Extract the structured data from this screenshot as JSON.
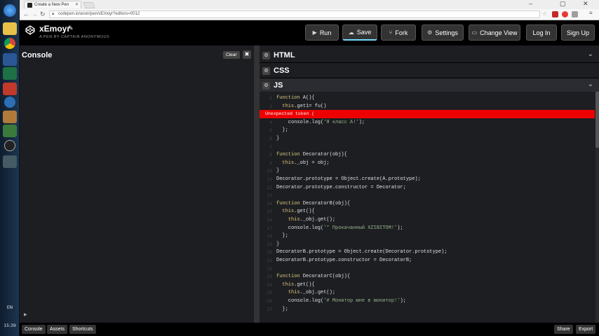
{
  "taskbar": {
    "icons": [
      "windows-start-icon",
      "folder-icon",
      "chrome-icon",
      "word-icon",
      "excel-icon",
      "app-icon",
      "globe-icon",
      "media-icon",
      "sound-icon",
      "obs-icon",
      "screen-icon"
    ],
    "lang": "EN",
    "time": "15:39"
  },
  "browser": {
    "tab_title": "Create a New Pen",
    "url": "codepen.io/anon/pen/xEmoyr?editors=0012"
  },
  "header": {
    "pen_title": "xEmoyr",
    "pen_subtitle": "A PEN BY CAPTAIN ANONYMOUS",
    "buttons": {
      "run": "Run",
      "save": "Save",
      "fork": "Fork",
      "settings": "Settings",
      "change_view": "Change View",
      "login": "Log In",
      "signup": "Sign Up"
    }
  },
  "console": {
    "title": "Console",
    "clear": "Clear",
    "prompt": "▶"
  },
  "editors": {
    "html": "HTML",
    "css": "CSS",
    "js": "JS"
  },
  "error": "Unexpected token (",
  "code_lines": [
    {
      "n": "1",
      "t": "function A(){"
    },
    {
      "n": "2",
      "t": "  this.get1= fu()"
    },
    {
      "n": "3",
      "t": ""
    },
    {
      "n": "4",
      "t": "    console.log('Я класс А!');"
    },
    {
      "n": "5",
      "t": "  };"
    },
    {
      "n": "6",
      "t": "}"
    },
    {
      "n": "7",
      "t": ""
    },
    {
      "n": "8",
      "t": "function Decorator(obj){"
    },
    {
      "n": "9",
      "t": "  this._obj = obj;"
    },
    {
      "n": "10",
      "t": "}"
    },
    {
      "n": "11",
      "t": "Decorator.prototype = Object.create(A.prototype);"
    },
    {
      "n": "12",
      "t": "Decorator.prototype.constructor = Decorator;"
    },
    {
      "n": "13",
      "t": ""
    },
    {
      "n": "14",
      "t": "function DecoratorB(obj){"
    },
    {
      "n": "15",
      "t": "  this.get(){"
    },
    {
      "n": "16",
      "t": "    this._obj.get();"
    },
    {
      "n": "17",
      "t": "    console.log('* Прокачанный XZIBITOM!');"
    },
    {
      "n": "18",
      "t": "  };"
    },
    {
      "n": "19",
      "t": "}"
    },
    {
      "n": "20",
      "t": "DecoratorB.prototype = Object.create(Decorator.prototype);"
    },
    {
      "n": "21",
      "t": "DecoratorB.prototype.constructor = DecoratorB;"
    },
    {
      "n": "22",
      "t": ""
    },
    {
      "n": "23",
      "t": "function DecoratorC(obj){"
    },
    {
      "n": "24",
      "t": "  this.get(){"
    },
    {
      "n": "25",
      "t": "    this._obj.get();"
    },
    {
      "n": "26",
      "t": "    console.log('# Монитор мне в монитор!');"
    },
    {
      "n": "27",
      "t": "  };"
    }
  ],
  "footer": {
    "console": "Console",
    "assets": "Assets",
    "shortcuts": "Shortcuts",
    "share": "Share",
    "export": "Export"
  },
  "colors": {
    "keyword": "#ddca7e",
    "string": "#96b38a",
    "property": "#9a8297",
    "error_red": "#ee0000"
  }
}
